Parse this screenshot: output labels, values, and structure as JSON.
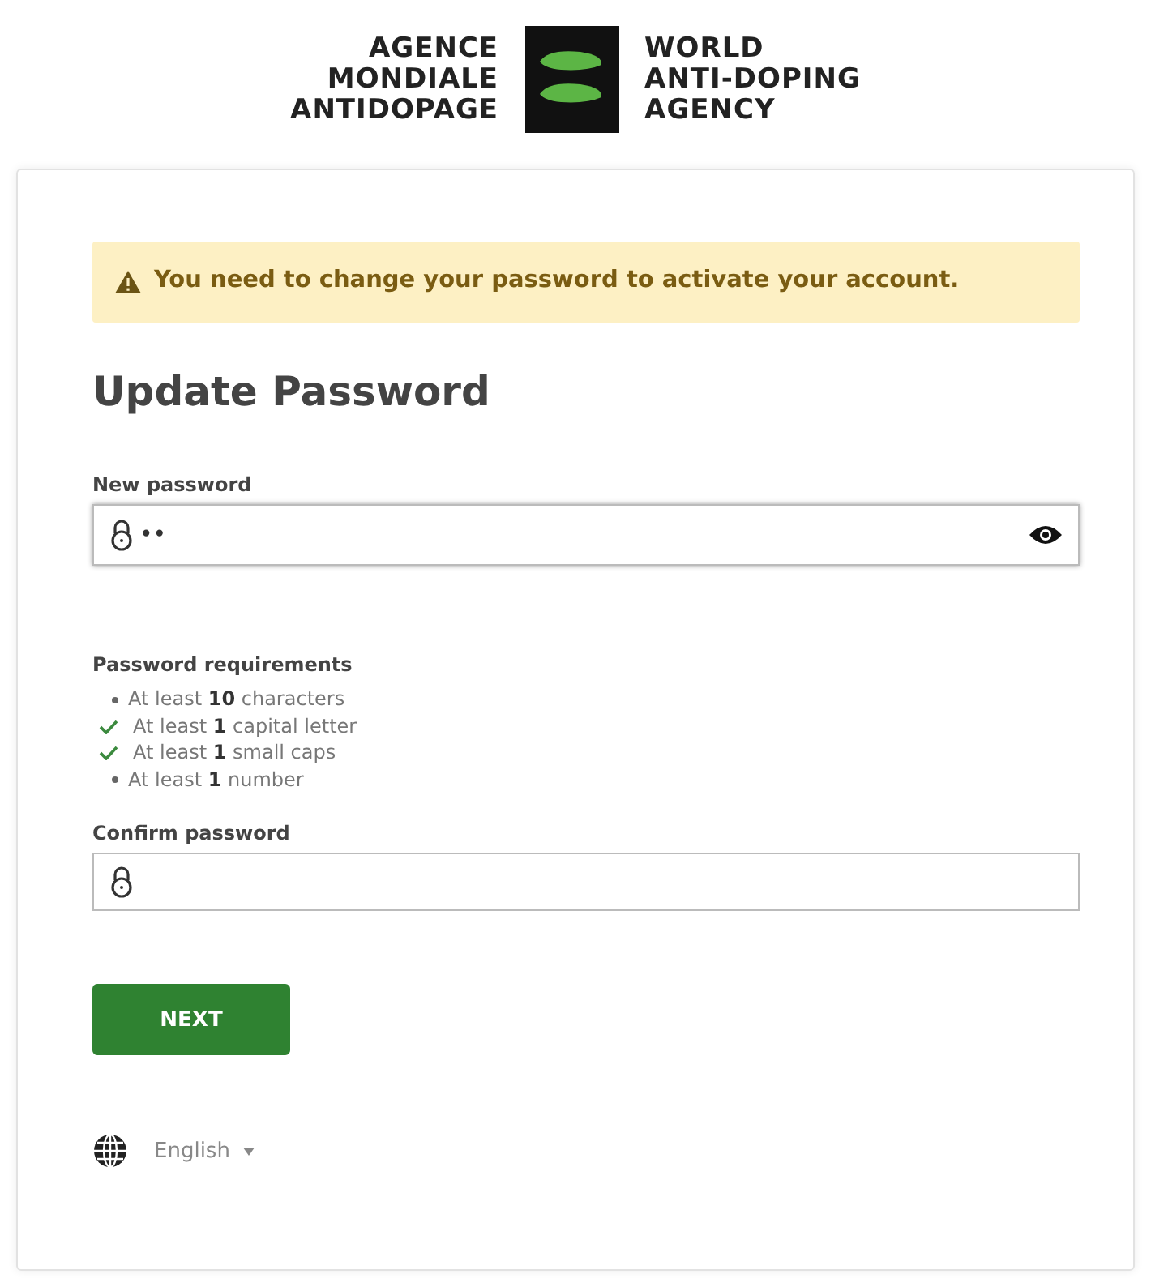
{
  "logo": {
    "left_lines": [
      "AGENCE",
      "MONDIALE",
      "ANTIDOPAGE"
    ],
    "right_lines": [
      "WORLD",
      "ANTI-DOPING",
      "AGENCY"
    ]
  },
  "alert": {
    "text": "You need to change your password to activate your account."
  },
  "title": "Update Password",
  "new_password": {
    "label": "New password",
    "value": "••"
  },
  "requirements": {
    "heading": "Password requirements",
    "items": [
      {
        "text": "At least **10** characters",
        "met": false
      },
      {
        "text": "At least **1** capital letter",
        "met": true
      },
      {
        "text": "At least **1** small caps",
        "met": true
      },
      {
        "text": "At least **1** number",
        "met": false
      }
    ]
  },
  "confirm_password": {
    "label": "Confirm password"
  },
  "next_button": "NEXT",
  "language": "English"
}
